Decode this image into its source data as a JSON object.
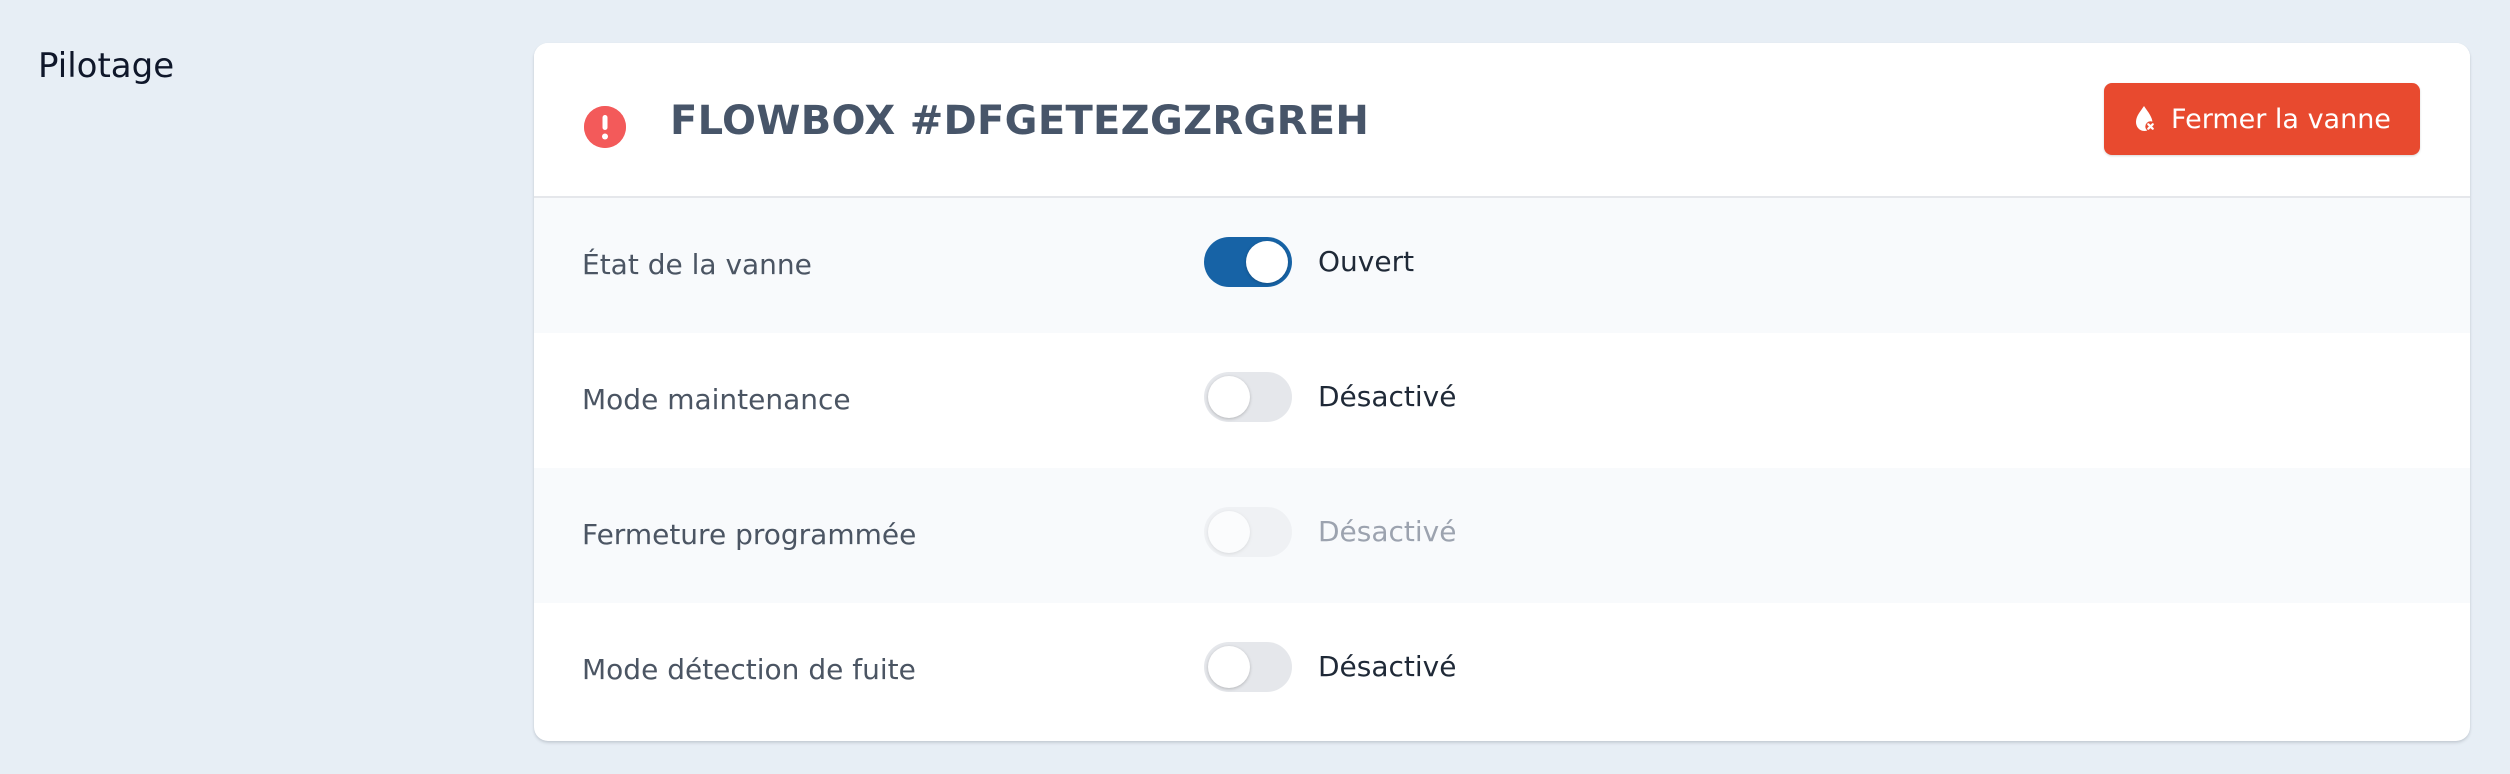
{
  "section": {
    "title": "Pilotage"
  },
  "device": {
    "title": "FLOWBOX #DFGETEZGZRGREH",
    "status_icon": "alert-circle-icon"
  },
  "actions": {
    "close_valve_label": "Fermer la vanne",
    "close_valve_icon": "droplet-off-icon",
    "button_color": "#E84A2F"
  },
  "settings": {
    "rows": [
      {
        "label": "État de la vanne",
        "state": "Ouvert",
        "enabled": true,
        "disabled": false
      },
      {
        "label": "Mode maintenance",
        "state": "Désactivé",
        "enabled": false,
        "disabled": false
      },
      {
        "label": "Fermeture programmée",
        "state": "Désactivé",
        "enabled": false,
        "disabled": true
      },
      {
        "label": "Mode détection de fuite",
        "state": "Désactivé",
        "enabled": false,
        "disabled": false
      }
    ]
  },
  "colors": {
    "background": "#E7EEF5",
    "toggle_on": "#1763A6",
    "alert": "#F35A5A"
  }
}
